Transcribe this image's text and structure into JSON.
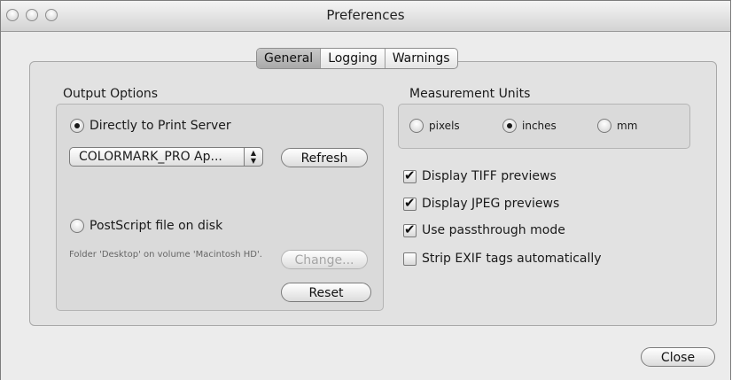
{
  "window": {
    "title": "Preferences"
  },
  "tabs": [
    {
      "label": "General",
      "selected": true
    },
    {
      "label": "Logging",
      "selected": false
    },
    {
      "label": "Warnings",
      "selected": false
    }
  ],
  "output_options": {
    "label": "Output Options",
    "print_server_radio": {
      "label": "Directly to Print Server",
      "selected": true
    },
    "printer_popup": {
      "value": "COLORMARK_PRO Ap..."
    },
    "refresh_button": "Refresh",
    "postscript_radio": {
      "label": "PostScript file on disk",
      "selected": false
    },
    "folder_note": "Folder 'Desktop' on volume 'Macintosh HD'.",
    "change_button": "Change...",
    "reset_button": "Reset"
  },
  "measurement_units": {
    "label": "Measurement Units",
    "options": [
      {
        "label": "pixels",
        "selected": false
      },
      {
        "label": "inches",
        "selected": true
      },
      {
        "label": "mm",
        "selected": false
      }
    ]
  },
  "checkboxes": [
    {
      "label": "Display TIFF previews",
      "checked": true
    },
    {
      "label": "Display JPEG previews",
      "checked": true
    },
    {
      "label": "Use passthrough mode",
      "checked": true
    },
    {
      "label": "Strip EXIF tags automatically",
      "checked": false
    }
  ],
  "close_button": "Close"
}
